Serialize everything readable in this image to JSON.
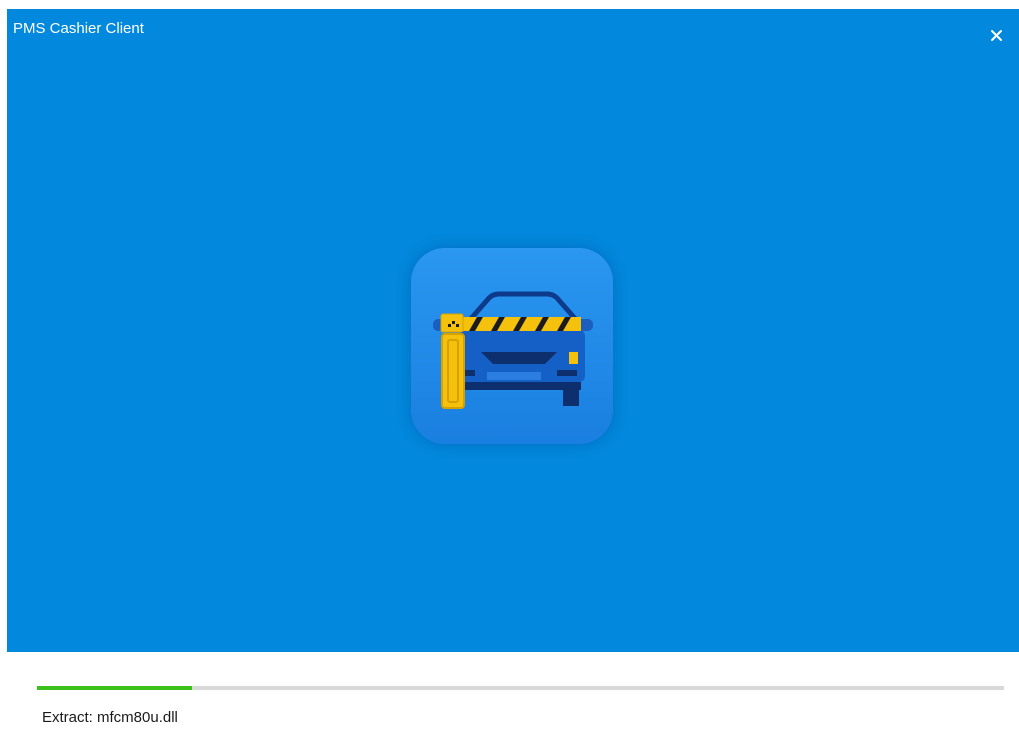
{
  "window": {
    "title": "PMS Cashier Client",
    "close_icon": "close-icon"
  },
  "banner": {
    "background_color": "#0288dc",
    "app_icon": "parking-gate-car-icon"
  },
  "progress": {
    "fraction": 0.16,
    "fill_color": "#3cbf1a",
    "track_color": "#d9d9d9"
  },
  "status": {
    "text": "Extract: mfcm80u.dll"
  }
}
